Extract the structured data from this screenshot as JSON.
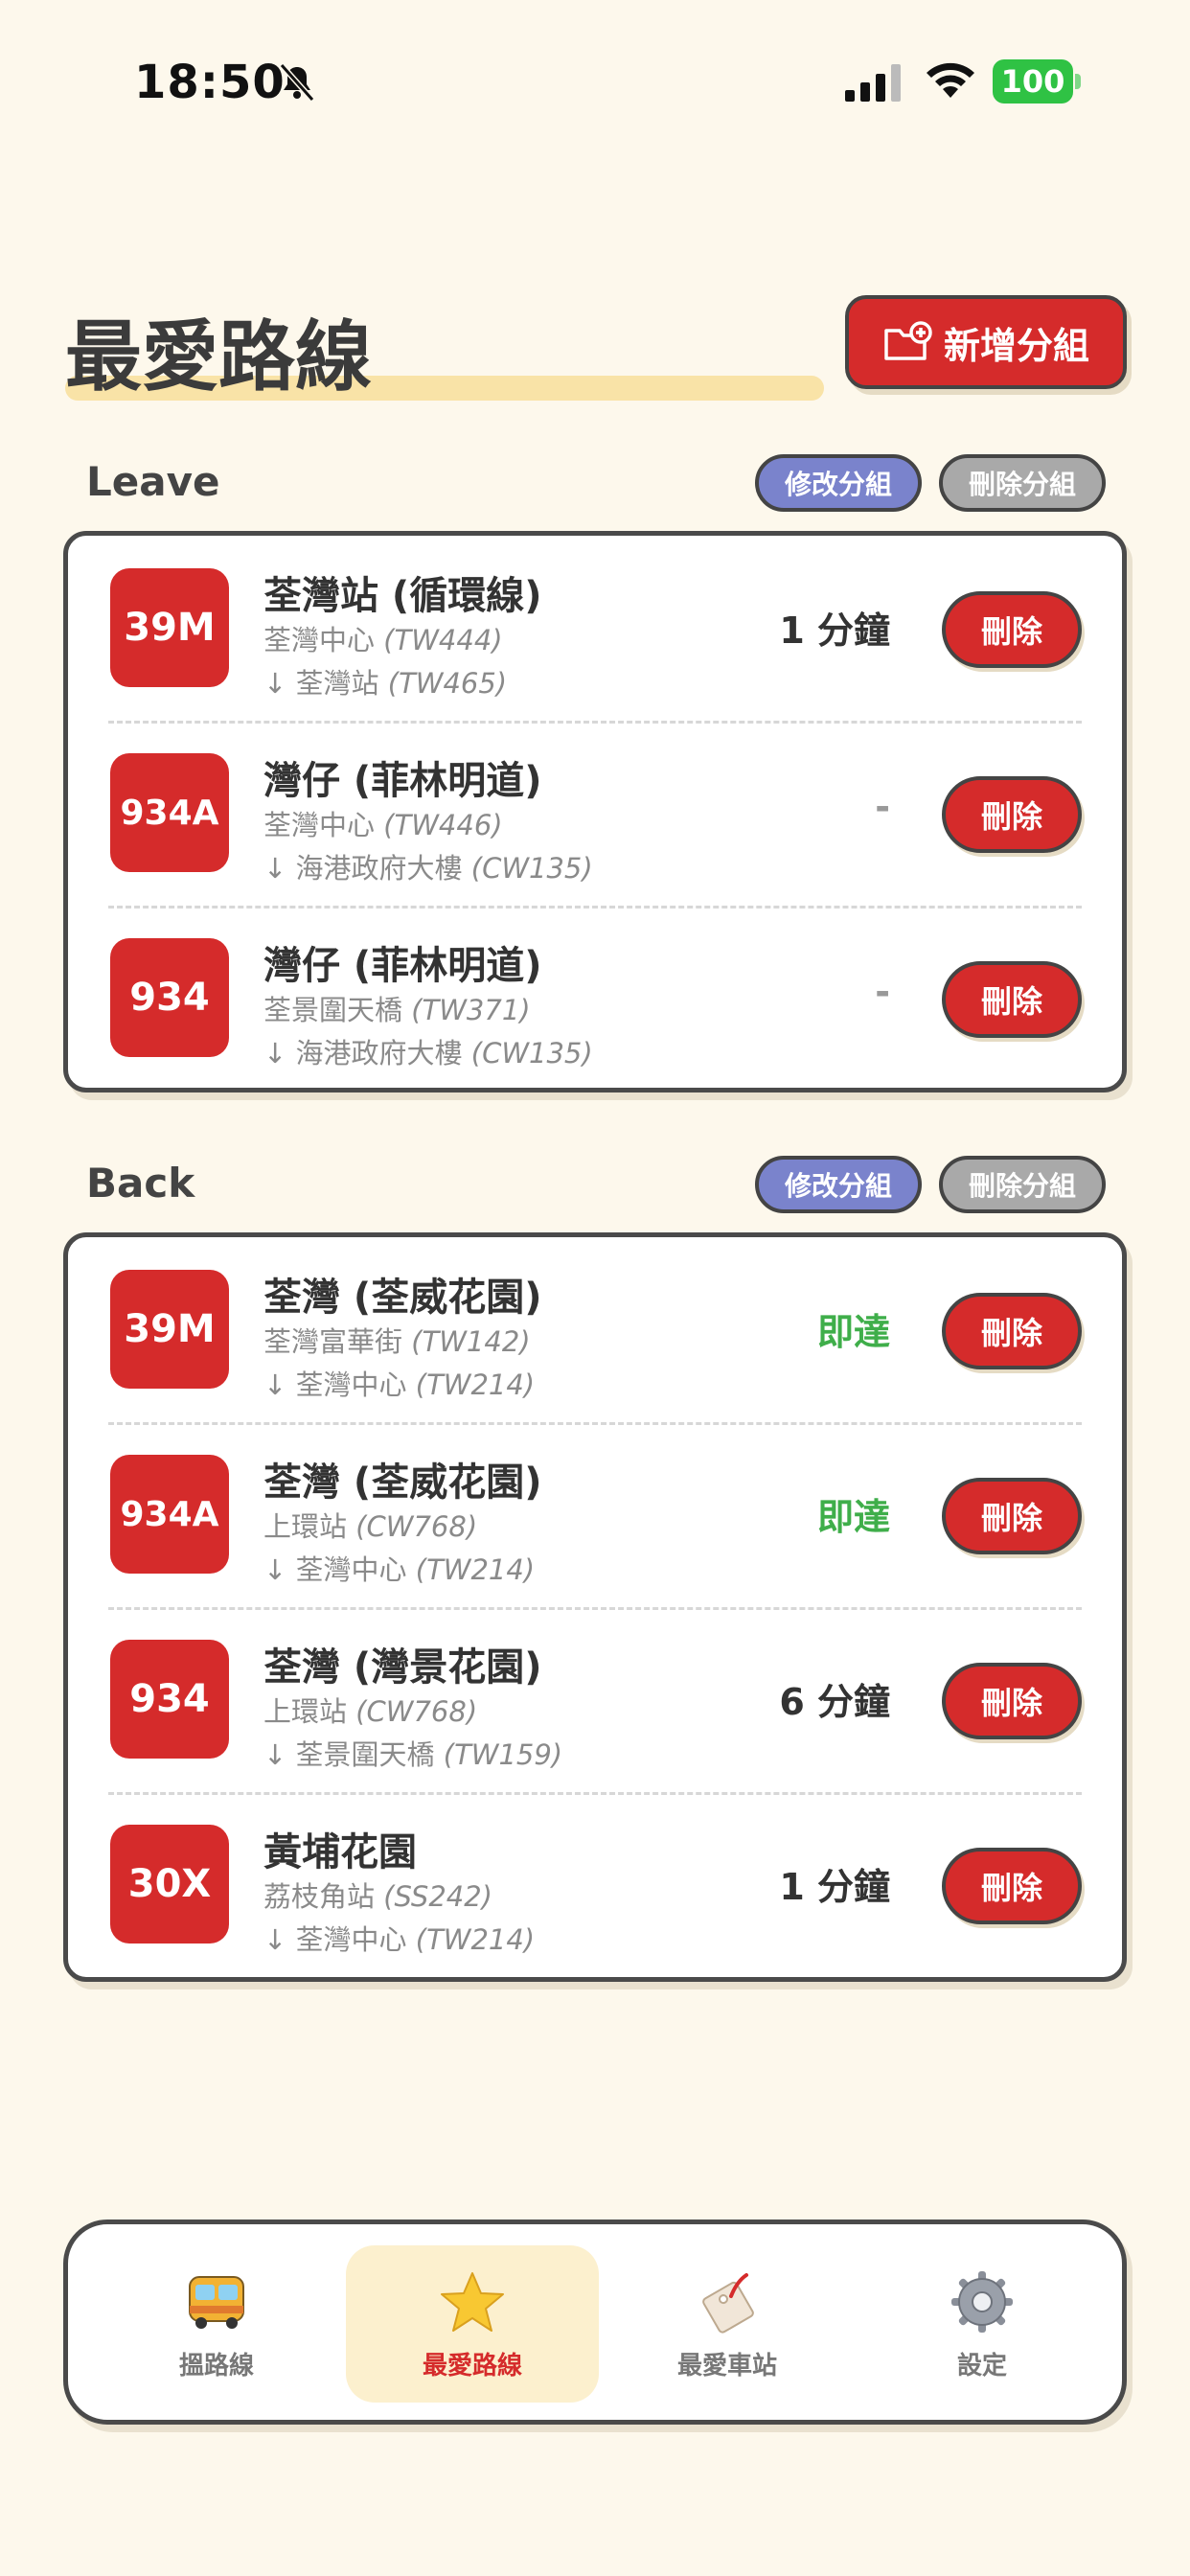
{
  "status_bar": {
    "time": "18:50",
    "battery": "100"
  },
  "header": {
    "title": "最愛路線",
    "add_group_label": "新增分組"
  },
  "groups": [
    {
      "name": "Leave",
      "edit_label": "修改分組",
      "delete_label": "刪除分組",
      "routes": [
        {
          "route": "39M",
          "destination": "荃灣站 (循環線)",
          "from_name": "荃灣中心",
          "from_code": "(TW444)",
          "to_name": "↓ 荃灣站",
          "to_code": "(TW465)",
          "eta": "1 分鐘",
          "delete_label": "刪除"
        },
        {
          "route": "934A",
          "destination": "灣仔 (菲林明道)",
          "from_name": "荃灣中心",
          "from_code": "(TW446)",
          "to_name": "↓ 海港政府大樓",
          "to_code": "(CW135)",
          "eta": "-",
          "delete_label": "刪除"
        },
        {
          "route": "934",
          "destination": "灣仔 (菲林明道)",
          "from_name": "荃景圍天橋",
          "from_code": "(TW371)",
          "to_name": "↓ 海港政府大樓",
          "to_code": "(CW135)",
          "eta": "-",
          "delete_label": "刪除"
        }
      ]
    },
    {
      "name": "Back",
      "edit_label": "修改分組",
      "delete_label": "刪除分組",
      "routes": [
        {
          "route": "39M",
          "destination": "荃灣 (荃威花園)",
          "from_name": "荃灣富華街",
          "from_code": "(TW142)",
          "to_name": "↓ 荃灣中心",
          "to_code": "(TW214)",
          "eta": "即達",
          "delete_label": "刪除"
        },
        {
          "route": "934A",
          "destination": "荃灣 (荃威花園)",
          "from_name": "上環站",
          "from_code": "(CW768)",
          "to_name": "↓ 荃灣中心",
          "to_code": "(TW214)",
          "eta": "即達",
          "delete_label": "刪除"
        },
        {
          "route": "934",
          "destination": "荃灣 (灣景花園)",
          "from_name": "上環站",
          "from_code": "(CW768)",
          "to_name": "↓ 荃景圍天橋",
          "to_code": "(TW159)",
          "eta": "6 分鐘",
          "delete_label": "刪除"
        },
        {
          "route": "30X",
          "destination": "黃埔花園",
          "from_name": "荔枝角站",
          "from_code": "(SS242)",
          "to_name": "↓ 荃灣中心",
          "to_code": "(TW214)",
          "eta": "1 分鐘",
          "delete_label": "刪除"
        }
      ]
    }
  ],
  "tabs": [
    {
      "label": "搵路線",
      "icon": "bus-icon",
      "active": false
    },
    {
      "label": "最愛路線",
      "icon": "star-icon",
      "active": true
    },
    {
      "label": "最愛車站",
      "icon": "bus-stop-tag-icon",
      "active": false
    },
    {
      "label": "設定",
      "icon": "gear-icon",
      "active": false
    }
  ],
  "colors": {
    "accent": "#D52B2B",
    "background": "#FDF8EC",
    "edit": "#7A83CC",
    "arrive": "#3FAE4A"
  }
}
